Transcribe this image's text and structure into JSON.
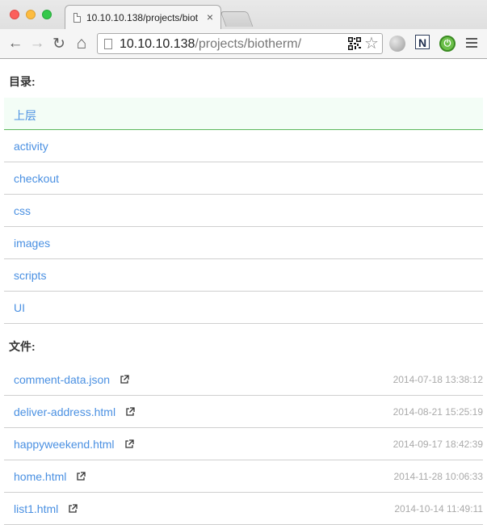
{
  "browser": {
    "tab_title": "10.10.10.138/projects/biot",
    "tab_close": "×",
    "url_host": "10.10.10.138",
    "url_path": "/projects/biotherm/",
    "back_icon": "←",
    "forward_icon": "→",
    "reload_icon": "↻",
    "home_icon": "⌂",
    "star_icon": "☆",
    "ext_n_label": "N"
  },
  "directories": {
    "title": "目录:",
    "items": [
      {
        "label": "上层",
        "active": true
      },
      {
        "label": "activity"
      },
      {
        "label": "checkout"
      },
      {
        "label": "css"
      },
      {
        "label": "images"
      },
      {
        "label": "scripts"
      },
      {
        "label": "UI"
      }
    ]
  },
  "files": {
    "title": "文件:",
    "items": [
      {
        "name": "comment-data.json",
        "time": "2014-07-18 13:38:12"
      },
      {
        "name": "deliver-address.html",
        "time": "2014-08-21 15:25:19"
      },
      {
        "name": "happyweekend.html",
        "time": "2014-09-17 18:42:39"
      },
      {
        "name": "home.html",
        "time": "2014-11-28 10:06:33"
      },
      {
        "name": "list1.html",
        "time": "2014-10-14 11:49:11"
      }
    ]
  },
  "colors": {
    "link": "#4a90e2",
    "active_row_bg": "#f3fdf6",
    "active_row_border": "#5cb85c",
    "timestamp": "#aaaaaa"
  }
}
